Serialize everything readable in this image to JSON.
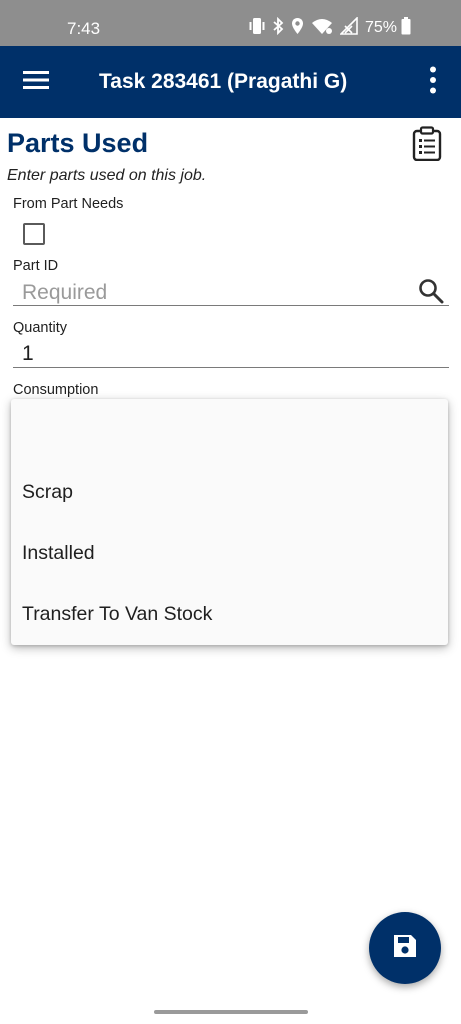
{
  "status_bar": {
    "time": "7:43",
    "battery": "75%",
    "icons": [
      "vibrate-icon",
      "bluetooth-icon",
      "location-icon",
      "wifi-icon",
      "signal-icon",
      "battery-icon"
    ]
  },
  "app_bar": {
    "title": "Task 283461 (Pragathi G)",
    "background": "#003069",
    "icons": [
      "menu-icon",
      "more-vertical-icon"
    ]
  },
  "page": {
    "title": "Parts Used",
    "subtitle": "Enter parts used on this job."
  },
  "form": {
    "from_part_needs_label": "From Part Needs",
    "from_part_needs_checked": false,
    "part_id_label": "Part ID",
    "part_id_placeholder": "Required",
    "part_id_value": "",
    "quantity_label": "Quantity",
    "quantity_value": "1",
    "consumption_label": "Consumption"
  },
  "consumption_dropdown": {
    "open": true,
    "options": [
      "",
      "Scrap",
      "Installed",
      "Transfer To Van Stock"
    ]
  },
  "fab": {
    "icon": "save-icon"
  },
  "colors": {
    "primary": "#003069",
    "status_bar": "#8e8e8e"
  }
}
